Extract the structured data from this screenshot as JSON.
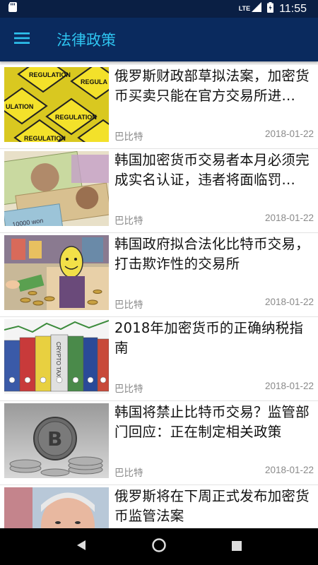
{
  "status_bar": {
    "network": "LTE",
    "time": "11:55",
    "icons": [
      "sd-card-icon",
      "signal-icon",
      "battery-icon"
    ]
  },
  "app_bar": {
    "title": "法律政策",
    "menu_icon": "hamburger-menu-icon"
  },
  "articles": [
    {
      "title": "俄罗斯财政部草拟法案，加密货币买卖只能在官方交易所进…",
      "source": "巴比特",
      "date": "2018-01-22",
      "image": "regulation-road-signs"
    },
    {
      "title": "韩国加密货币交易者本月必须完成实名认证，违者将面临罚…",
      "source": "巴比特",
      "date": "2018-01-22",
      "image": "korean-won-banknotes"
    },
    {
      "title": "韩国政府拟合法化比特币交易，打击欺诈性的交易所",
      "source": "巴比特",
      "date": "2018-01-22",
      "image": "masked-trader-illustration"
    },
    {
      "title": "2018年加密货币的正确纳税指南",
      "source": "巴比特",
      "date": "2018-01-22",
      "image": "crypto-tax-binders"
    },
    {
      "title": "韩国将禁止比特币交易？监管部门回应：正在制定相关政策",
      "source": "巴比特",
      "date": "2018-01-22",
      "image": "bitcoin-coin-stacks"
    },
    {
      "title": "俄罗斯将在下周正式发布加密货币监管法案",
      "source": "",
      "date": "",
      "image": "russian-official-portrait"
    }
  ],
  "nav_bar": {
    "back_icon": "back-triangle-icon",
    "home_icon": "home-circle-icon",
    "recents_icon": "recents-square-icon"
  }
}
